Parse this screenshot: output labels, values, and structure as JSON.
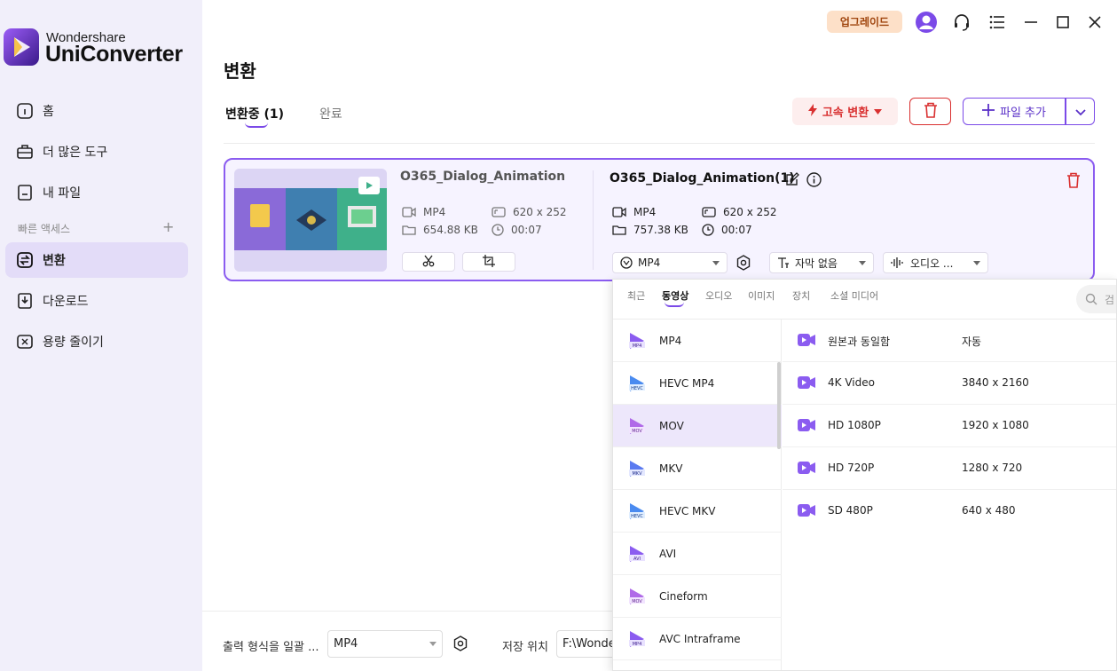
{
  "brand": {
    "small": "Wondershare",
    "big": "UniConverter"
  },
  "sidebar": {
    "items": [
      {
        "label": "홈"
      },
      {
        "label": "더 많은 도구"
      },
      {
        "label": "내 파일"
      },
      {
        "label": "변환"
      },
      {
        "label": "다운로드"
      },
      {
        "label": "용량 줄이기"
      }
    ],
    "quick_access_label": "빠른 액세스",
    "quick_access_add": "+"
  },
  "topbar": {
    "upgrade_label": "업그레이드"
  },
  "page": {
    "title": "변환",
    "tabs": {
      "converting": "변환중 (1)",
      "done": "완료"
    },
    "fast_convert_label": "고속 변환",
    "add_file_label": "파일 추가"
  },
  "file": {
    "source": {
      "title": "O365_Dialog_Animation",
      "format": "MP4",
      "size": "654.88 KB",
      "resolution": "620 x 252",
      "duration": "00:07"
    },
    "output": {
      "title": "O365_Dialog_Animation(1)",
      "format": "MP4",
      "size": "757.38 KB",
      "resolution": "620 x 252",
      "duration": "00:07"
    },
    "format_select": "MP4",
    "subtitle_select": "자막 없음",
    "audio_select": "오디오 ..."
  },
  "bottombar": {
    "output_format_label": "출력 형식을 일괄 ...",
    "output_format_value": "MP4",
    "save_location_label": "저장 위치",
    "save_location_value": "F:\\Wonde"
  },
  "format_popup": {
    "tabs": [
      "최근",
      "동영상",
      "오디오",
      "이미지",
      "장치",
      "소셜 미디어"
    ],
    "active_tab": "동영상",
    "search_placeholder": "검",
    "formats": [
      {
        "name": "MP4",
        "badge": "MP4"
      },
      {
        "name": "HEVC MP4",
        "badge": "HEVC"
      },
      {
        "name": "MOV",
        "badge": "MOV"
      },
      {
        "name": "MKV",
        "badge": "MKV"
      },
      {
        "name": "HEVC MKV",
        "badge": "HEVC"
      },
      {
        "name": "AVI",
        "badge": "AVI"
      },
      {
        "name": "Cineform",
        "badge": "MOV"
      },
      {
        "name": "AVC Intraframe",
        "badge": "MP4"
      }
    ],
    "selected_format": "MOV",
    "qualities": [
      {
        "name": "원본과 동일함",
        "resolution": "자동"
      },
      {
        "name": "4K Video",
        "resolution": "3840 x 2160"
      },
      {
        "name": "HD 1080P",
        "resolution": "1920 x 1080"
      },
      {
        "name": "HD 720P",
        "resolution": "1280 x 720"
      },
      {
        "name": "SD 480P",
        "resolution": "640 x 480"
      }
    ]
  },
  "colors": {
    "accent": "#7b4ae8",
    "danger": "#d93030",
    "sidebar_bg": "#f1effa",
    "upgrade_bg": "#fde0c8"
  }
}
